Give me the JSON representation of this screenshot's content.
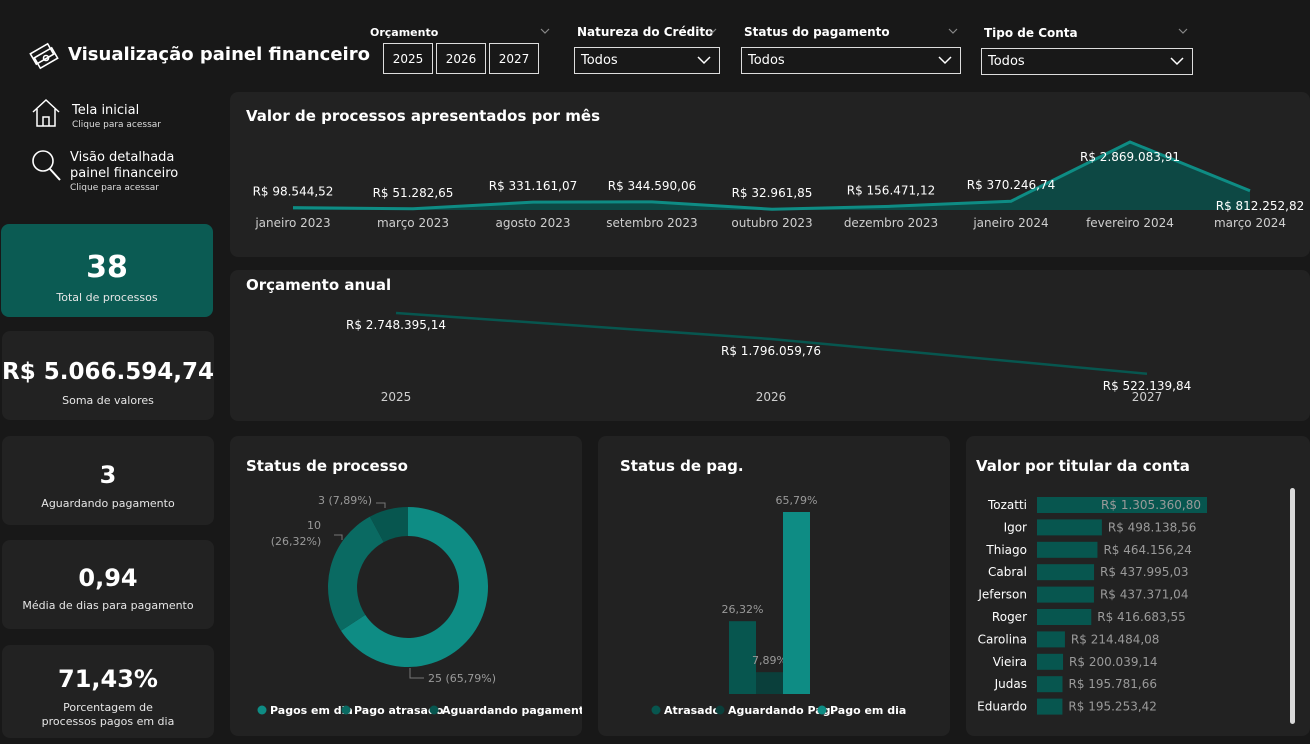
{
  "header": {
    "title": "Visualização painel financeiro",
    "filters": {
      "orcamento": {
        "label": "Orçamento",
        "years": [
          "2025",
          "2026",
          "2027"
        ]
      },
      "natureza": {
        "label": "Natureza do Crédito",
        "value": "Todos"
      },
      "status_pag": {
        "label": "Status do pagamento",
        "value": "Todos"
      },
      "tipo_conta": {
        "label": "Tipo de Conta",
        "value": "Todos"
      }
    }
  },
  "nav": {
    "home": {
      "title": "Tela inicial",
      "sub": "Clique para acessar"
    },
    "detail": {
      "title_line1": "Visão detalhada",
      "title_line2": "painel financeiro",
      "sub": "Clique para acessar"
    }
  },
  "kpis": {
    "total": {
      "value": "38",
      "label": "Total de processos"
    },
    "soma": {
      "value": "R$ 5.066.594,74",
      "label": "Soma de valores"
    },
    "aguardando": {
      "value": "3",
      "label": "Aguardando pagamento"
    },
    "media": {
      "value": "0,94",
      "label": "Média de dias para pagamento"
    },
    "porcentagem": {
      "value": "71,43%",
      "label_line1": "Porcentagem de",
      "label_line2": "processos pagos em dia"
    }
  },
  "colors": {
    "accent": "#0e8c84",
    "accent_dark": "#07564f",
    "accent_mid": "#0a6a62",
    "card": "#222222",
    "background": "#181818"
  },
  "chart_data": [
    {
      "type": "area",
      "title": "Valor de processos apresentados por mês",
      "categories": [
        "janeiro 2023",
        "março 2023",
        "agosto 2023",
        "setembro 2023",
        "outubro 2023",
        "dezembro 2023",
        "janeiro 2024",
        "fevereiro 2024",
        "março 2024"
      ],
      "values": [
        98544.52,
        51282.65,
        331161.07,
        344590.06,
        32961.85,
        156471.12,
        370246.74,
        2869083.91,
        812252.82
      ],
      "labels": [
        "R$ 98.544,52",
        "R$ 51.282,65",
        "R$ 331.161,07",
        "R$ 344.590,06",
        "R$ 32.961,85",
        "R$ 156.471,12",
        "R$ 370.246,74",
        "R$ 2.869.083,91",
        "R$ 812.252,82"
      ]
    },
    {
      "type": "line",
      "title": "Orçamento anual",
      "categories": [
        "2025",
        "2026",
        "2027"
      ],
      "values": [
        2748395.14,
        1796059.76,
        522139.84
      ],
      "labels": [
        "R$ 2.748.395,14",
        "R$ 1.796.059,76",
        "R$ 522.139,84"
      ]
    },
    {
      "type": "pie",
      "title": "Status de processo",
      "categories": [
        "Pagos em dia",
        "Pago atrasado",
        "Aguardando pagamento"
      ],
      "values": [
        25,
        10,
        3
      ],
      "labels": [
        "25 (65,79%)",
        "10",
        "(26,32%)",
        "3 (7,89%)"
      ],
      "legend": "bottom"
    },
    {
      "type": "bar",
      "title": "Status de pag.",
      "categories": [
        "Atrasado",
        "Aguardando Pag.",
        "Pago em dia"
      ],
      "values": [
        26.32,
        7.89,
        65.79
      ],
      "labels": [
        "26,32%",
        "7,89%",
        "65,79%"
      ],
      "legend": "bottom"
    },
    {
      "type": "bar",
      "title": "Valor por titular da conta",
      "categories": [
        "Tozatti",
        "Igor",
        "Thiago",
        "Cabral",
        "Jeferson",
        "Roger",
        "Carolina",
        "Vieira",
        "Judas",
        "Eduardo"
      ],
      "values": [
        1305360.8,
        498138.56,
        464156.24,
        437995.03,
        437371.04,
        416683.55,
        214484.08,
        200039.14,
        195781.66,
        195253.42
      ],
      "labels": [
        "R$ 1.305.360,80",
        "R$ 498.138,56",
        "R$ 464.156,24",
        "R$ 437.995,03",
        "R$ 437.371,04",
        "R$ 416.683,55",
        "R$ 214.484,08",
        "R$ 200.039,14",
        "R$ 195.781,66",
        "R$ 195.253,42"
      ]
    }
  ]
}
